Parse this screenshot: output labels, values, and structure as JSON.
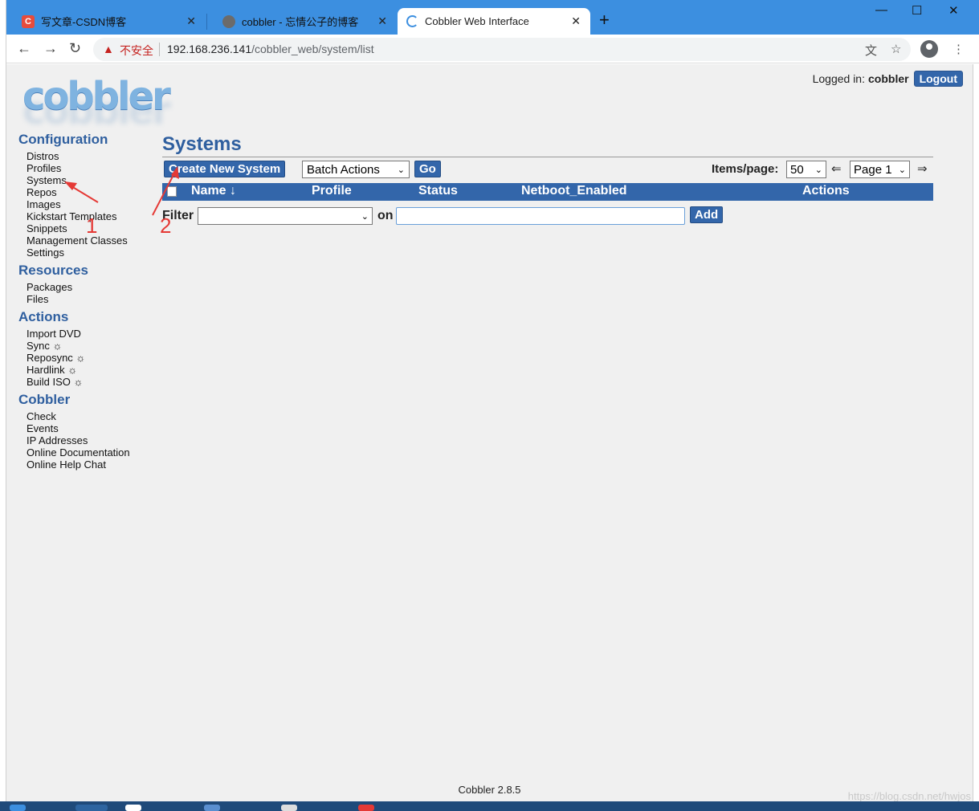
{
  "browser": {
    "tabs": [
      {
        "title": "写文章-CSDN博客",
        "favicon_color": "#e74c3c",
        "favicon_glyph": "C"
      },
      {
        "title": "cobbler - 忘情公子的博客",
        "favicon_color": "#6b6b6b",
        "favicon_glyph": ""
      },
      {
        "title": "Cobbler Web Interface",
        "favicon_color": "#3c8fe0",
        "favicon_glyph": ""
      }
    ],
    "url_warning": "不安全",
    "url_host": "192.168.236.141",
    "url_path": "/cobbler_web/system/list"
  },
  "header": {
    "logo_text": "cobbler",
    "logged_in_label": "Logged in:",
    "username": "cobbler",
    "logout_label": "Logout"
  },
  "sidebar": {
    "sections": [
      {
        "title": "Configuration",
        "items": [
          "Distros",
          "Profiles",
          "Systems",
          "Repos",
          "Images",
          "Kickstart Templates",
          "Snippets",
          "Management Classes",
          "Settings"
        ]
      },
      {
        "title": "Resources",
        "items": [
          "Packages",
          "Files"
        ]
      },
      {
        "title": "Actions",
        "items": [
          "Import DVD",
          "Sync ☼",
          "Reposync ☼",
          "Hardlink ☼",
          "Build ISO ☼"
        ]
      },
      {
        "title": "Cobbler",
        "items": [
          "Check",
          "Events",
          "IP Addresses",
          "Online Documentation",
          "Online Help Chat"
        ]
      }
    ]
  },
  "main": {
    "title": "Systems",
    "create_button": "Create New System",
    "batch_select": "Batch Actions",
    "go_button": "Go",
    "items_per_page_label": "Items/page:",
    "items_per_page_value": "50",
    "page_value": "Page 1",
    "prev_arrow": "⇐",
    "next_arrow": "⇒",
    "columns": [
      "Name ↓",
      "Profile",
      "Status",
      "Netboot_Enabled",
      "Actions"
    ],
    "filter_label": "Filter",
    "filter_on_label": "on",
    "filter_input_value": "",
    "add_button": "Add"
  },
  "annotations": {
    "label1": "1",
    "label2": "2",
    "color": "#e53935"
  },
  "footer": {
    "version": "Cobbler 2.8.5",
    "watermark": "https://blog.csdn.net/hwjos"
  }
}
